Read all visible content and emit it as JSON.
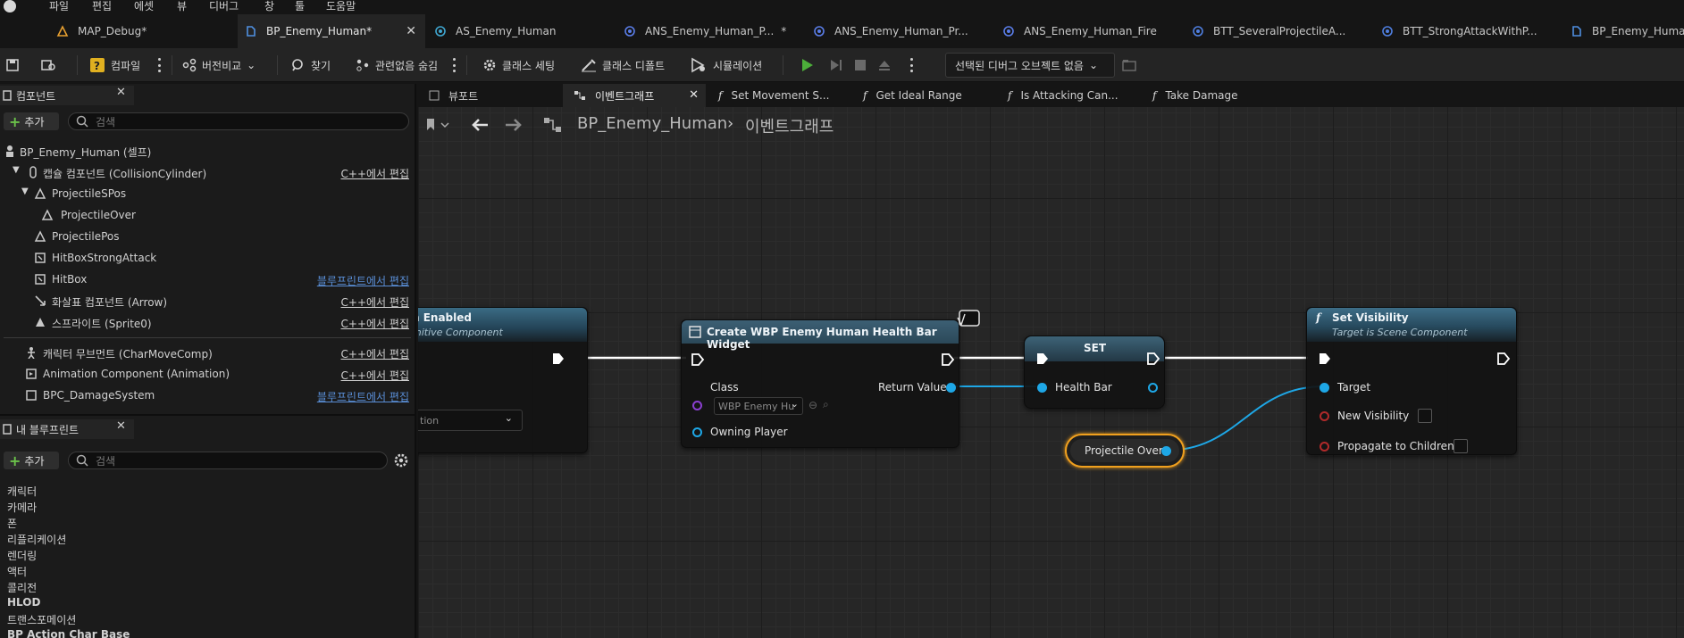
{
  "menu": [
    "파일",
    "편집",
    "에셋",
    "뷰",
    "디버그",
    "창",
    "툴",
    "도움말"
  ],
  "tabs": [
    {
      "label": "MAP_Debug*",
      "icon": "level-icon"
    },
    {
      "label": "BP_Enemy_Human*",
      "icon": "blueprint-icon",
      "active": true
    },
    {
      "label": "AS_Enemy_Human",
      "icon": "anim-sequence-icon"
    },
    {
      "label": "ANS_Enemy_Human_P...",
      "icon": "anim-notify-icon",
      "modified": "*"
    },
    {
      "label": "ANS_Enemy_Human_Pr...",
      "icon": "anim-notify-icon"
    },
    {
      "label": "ANS_Enemy_Human_Fire",
      "icon": "anim-notify-icon"
    },
    {
      "label": "BTT_SeveralProjectileA...",
      "icon": "bt-task-icon"
    },
    {
      "label": "BTT_StrongAttackWithP...",
      "icon": "bt-task-icon"
    },
    {
      "label": "BP_Enemy_Human",
      "icon": "blueprint-icon"
    }
  ],
  "toolbar": {
    "compile": "컴파일",
    "diff": "버전비교",
    "find": "찾기",
    "hide_unrelated": "관련없음 숨김",
    "class_settings": "클래스 세팅",
    "class_defaults": "클래스 디폴트",
    "simulation": "시뮬레이션",
    "debug_object": "선택된 디버그 오브젝트 없음"
  },
  "components": {
    "title": "컴포넌트",
    "add": "추가",
    "search_placeholder": "검색",
    "rows": [
      {
        "name": "BP_Enemy_Human (셀프)",
        "edit": ""
      },
      {
        "name": "캡슐 컴포넌트 (CollisionCylinder)",
        "edit": "C++에서 편집"
      },
      {
        "name": "ProjectileSPos",
        "edit": ""
      },
      {
        "name": "ProjectileOver",
        "edit": ""
      },
      {
        "name": "ProjectilePos",
        "edit": ""
      },
      {
        "name": "HitBoxStrongAttack",
        "edit": ""
      },
      {
        "name": "HitBox",
        "edit": "블루프린트에서 편집"
      },
      {
        "name": "화살표 컴포넌트 (Arrow)",
        "edit": "C++에서 편집"
      },
      {
        "name": "스프라이트 (Sprite0)",
        "edit": "C++에서 편집"
      },
      {
        "name": "캐릭터 무브먼트 (CharMoveComp)",
        "edit": "C++에서 편집"
      },
      {
        "name": "Animation Component (Animation)",
        "edit": "C++에서 편집"
      },
      {
        "name": "BPC_DamageSystem",
        "edit": "블루프린트에서 편집"
      }
    ]
  },
  "my_blueprint": {
    "title": "내 블루프린트",
    "add": "추가",
    "search_placeholder": "검색",
    "categories": [
      "캐릭터",
      "카메라",
      "폰",
      "리플리케이션",
      "렌더링",
      "액터",
      "콜리전",
      "HLOD",
      "트랜스포메이션",
      "BP Action Char Base"
    ]
  },
  "graph": {
    "tabs": [
      {
        "label": "뷰포트",
        "icon": "viewport-icon"
      },
      {
        "label": "이벤트그래프",
        "icon": "event-graph-icon",
        "active": true
      },
      {
        "label": "Set Movement S...",
        "icon": "function-icon"
      },
      {
        "label": "Get Ideal Range",
        "icon": "function-icon"
      },
      {
        "label": "Is Attacking Can...",
        "icon": "function-icon"
      },
      {
        "label": "Take Damage",
        "icon": "function-icon"
      }
    ],
    "breadcrumb": [
      "BP_Enemy_Human",
      "이벤트그래프"
    ],
    "nodes": {
      "event": {
        "title": "n Enabled",
        "subtitle": "mitive Component",
        "dropdown": "tion"
      },
      "create_widget": {
        "title": "Create WBP Enemy Human Health Bar Widget",
        "class_label": "Class",
        "class_value": "WBP Enemy Hu",
        "return_value": "Return Value",
        "owning_player": "Owning Player"
      },
      "set": {
        "title": "SET",
        "health_bar": "Health Bar"
      },
      "projectile_over": {
        "label": "Projectile Over"
      },
      "set_visibility": {
        "title": "Set Visibility",
        "subtitle": "Target is Scene Component",
        "target": "Target",
        "new_visibility": "New Visibility",
        "propagate": "Propagate to Children"
      }
    }
  },
  "colors": {
    "accent_blue": "#1ea7e6",
    "exec_white": "#ffffff",
    "selected_orange": "#f0a01e",
    "bp_link": "#5a8fd8",
    "play_green": "#4caf3a"
  }
}
